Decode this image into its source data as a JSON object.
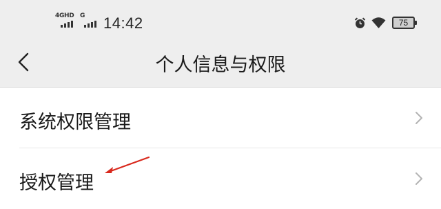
{
  "status_bar": {
    "network_primary": "4GHD",
    "network_secondary": "G",
    "time": "14:42",
    "battery_level": "75",
    "icons": [
      "signal-icon",
      "alarm-icon",
      "wifi-icon",
      "battery-icon"
    ]
  },
  "header": {
    "title": "个人信息与权限",
    "back_icon": "chevron-left-icon"
  },
  "list": {
    "items": [
      {
        "label": "系统权限管理",
        "icon": "chevron-right-icon"
      },
      {
        "label": "授权管理",
        "icon": "chevron-right-icon"
      }
    ]
  },
  "annotation": {
    "type": "red-arrow",
    "target": "授权管理",
    "color": "#d9281c"
  },
  "colors": {
    "header_bg": "#eeeeee",
    "list_bg": "#ffffff",
    "divider": "#e6e6e6",
    "chevron": "#b3b3b3"
  }
}
